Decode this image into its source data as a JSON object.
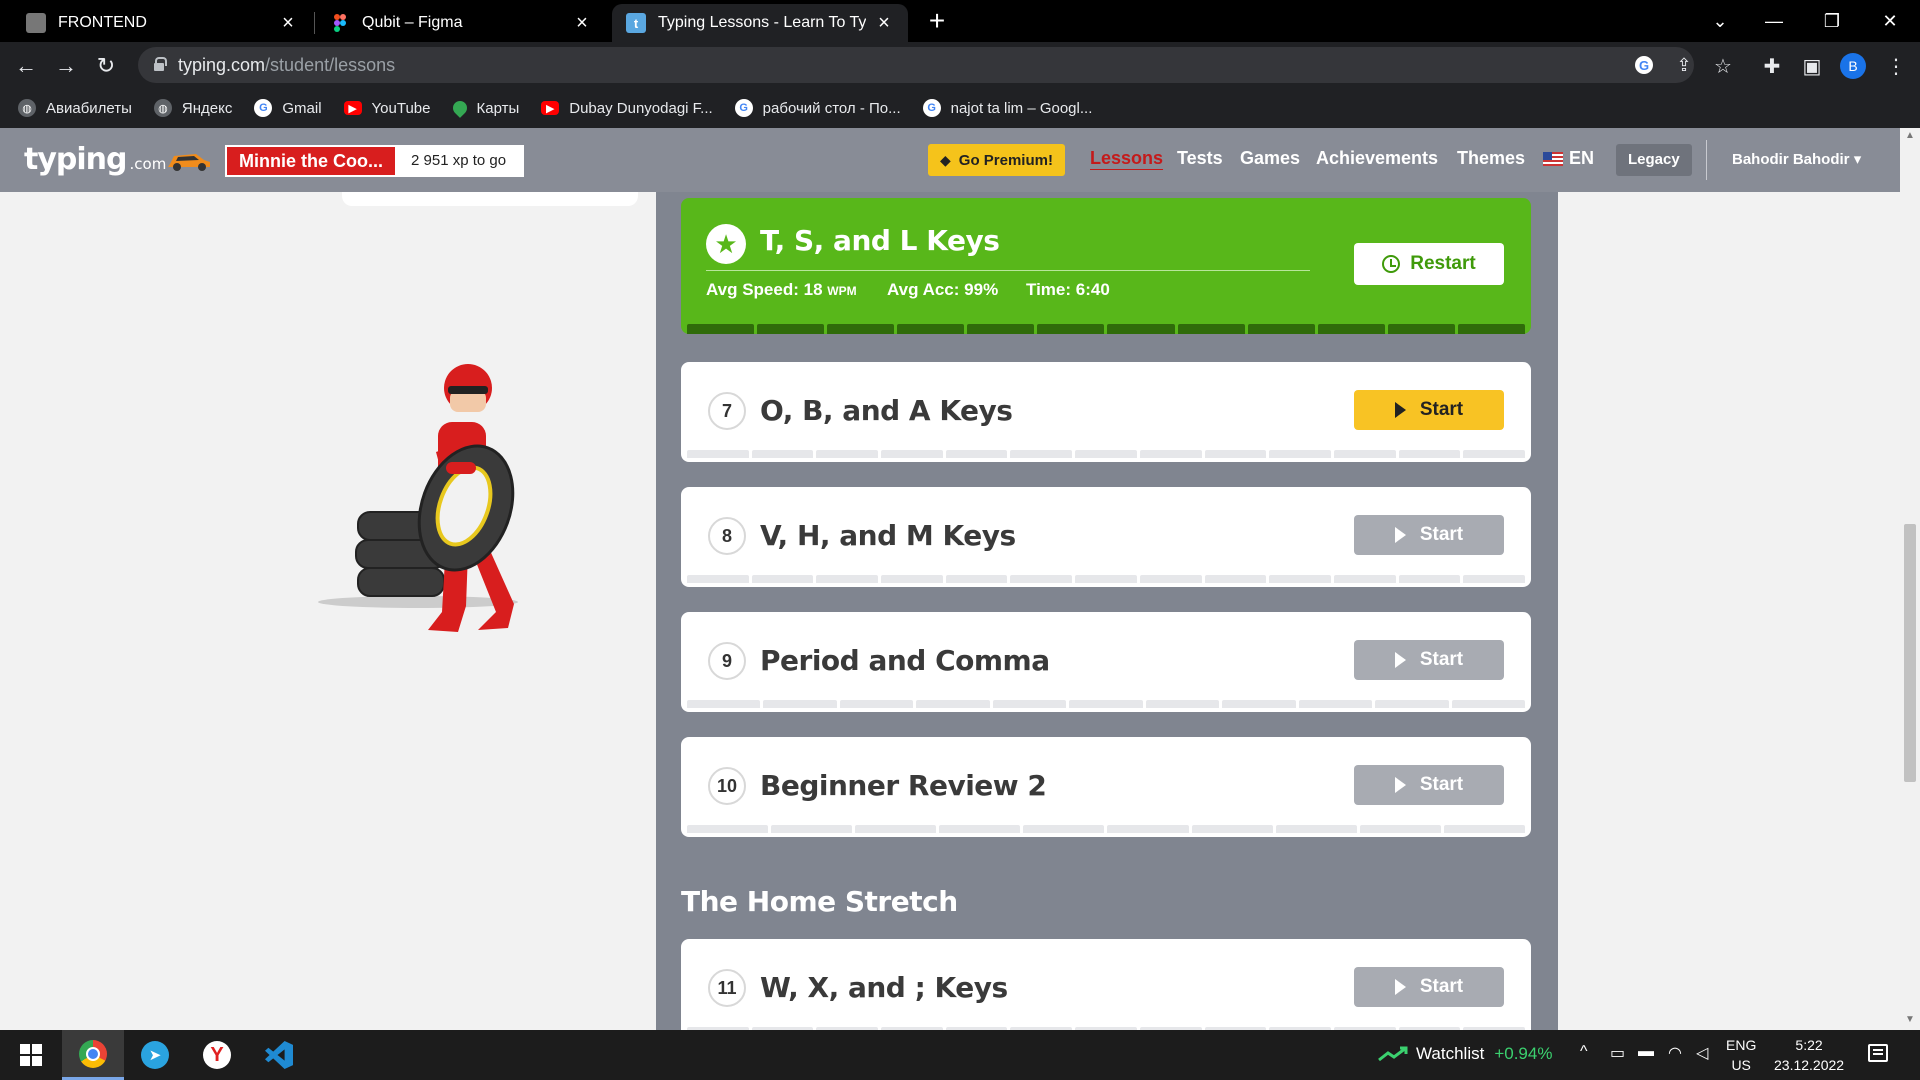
{
  "browser": {
    "tabs": [
      {
        "title": "FRONTEND",
        "icon": "frontend-favicon"
      },
      {
        "title": "Qubit – Figma",
        "icon": "figma-icon"
      },
      {
        "title": "Typing Lessons - Learn To Type A",
        "icon": "typing-favicon",
        "favicon_letter": "t",
        "active": true
      }
    ],
    "new_tab": "+",
    "window_controls": {
      "minimize": "—",
      "restore": "❐",
      "close": "✕",
      "tab_list": "⌄"
    },
    "nav": {
      "back": "←",
      "forward": "→",
      "reload": "↻"
    },
    "url_host": "typing.com",
    "url_path": "/student/lessons",
    "profile_initial": "B",
    "bookmarks": [
      {
        "label": "Авиабилеты",
        "icon": "globe-icon",
        "color": "#e8eaed"
      },
      {
        "label": "Яндекс",
        "icon": "globe-icon",
        "color": "#e8eaed"
      },
      {
        "label": "Gmail",
        "icon": "google-icon",
        "color": "#4285f4"
      },
      {
        "label": "YouTube",
        "icon": "youtube-icon",
        "color": "#ff0000"
      },
      {
        "label": "Карты",
        "icon": "maps-pin-icon",
        "color": "#34a853"
      },
      {
        "label": "Dubay Dunyodagi F...",
        "icon": "youtube-icon",
        "color": "#ff0000"
      },
      {
        "label": "рабочий стол - По...",
        "icon": "google-icon",
        "color": "#4285f4"
      },
      {
        "label": "najot ta lim – Googl...",
        "icon": "google-icon",
        "color": "#4285f4"
      }
    ]
  },
  "site": {
    "logo": "typing",
    "logo_suffix": ".com",
    "rank_name": "Minnie the Coo...",
    "rank_xp": "2 951 xp to go",
    "premium_label": "Go Premium!",
    "nav": [
      {
        "label": "Lessons",
        "active": true
      },
      {
        "label": "Tests"
      },
      {
        "label": "Games"
      },
      {
        "label": "Achievements"
      },
      {
        "label": "Themes"
      }
    ],
    "language": "EN",
    "legacy_label": "Legacy",
    "user_name": "Bahodir Bahodir",
    "user_caret": "▾"
  },
  "completed_lesson": {
    "title": "T, S, and L Keys",
    "avg_speed_label": "Avg Speed:",
    "avg_speed_value": "18",
    "avg_speed_unit": "WPM",
    "avg_acc_label": "Avg Acc:",
    "avg_acc_value": "99%",
    "time_label": "Time:",
    "time_value": "6:40",
    "button": "Restart",
    "star_icon": "★"
  },
  "lessons": [
    {
      "number": "7",
      "title": "O, B, and A Keys",
      "button": "Start",
      "available": true
    },
    {
      "number": "8",
      "title": "V, H, and M Keys",
      "button": "Start",
      "available": false
    },
    {
      "number": "9",
      "title": "Period and Comma",
      "button": "Start",
      "available": false
    },
    {
      "number": "10",
      "title": "Beginner Review 2",
      "button": "Start",
      "available": false
    }
  ],
  "section_title": "The Home Stretch",
  "next_section_lessons": [
    {
      "number": "11",
      "title": "W, X, and ; Keys",
      "button": "Start",
      "available": false
    }
  ],
  "taskbar": {
    "watchlist_label": "Watchlist",
    "watchlist_change": "+0.94%",
    "lang_line1": "ENG",
    "lang_line2": "US",
    "time": "5:22",
    "date": "23.12.2022",
    "tray_up": "^"
  },
  "colors": {
    "header_bg": "#888c96",
    "column_bg": "#808590",
    "completed_green": "#58b71a",
    "start_yellow": "#f8c324",
    "start_disabled": "#a8abb2",
    "rank_red": "#d81e1e",
    "premium_yellow": "#f5c31b"
  }
}
